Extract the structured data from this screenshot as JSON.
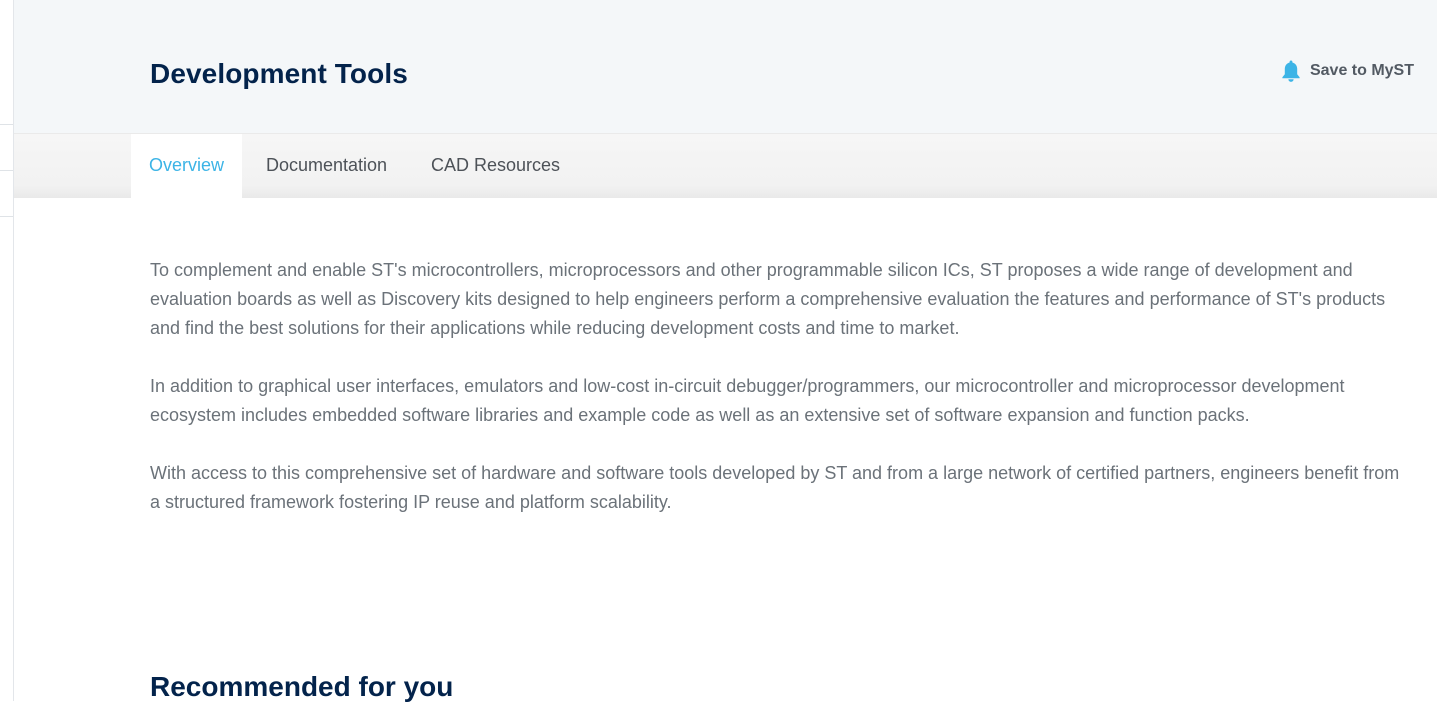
{
  "header": {
    "title": "Development Tools",
    "save_label": "Save to MyST",
    "save_icon": "bell-icon"
  },
  "tabs": [
    {
      "label": "Overview",
      "active": true
    },
    {
      "label": "Documentation",
      "active": false
    },
    {
      "label": "CAD Resources",
      "active": false
    }
  ],
  "overview": {
    "paragraphs": [
      "To complement and enable ST's microcontrollers, microprocessors and other programmable silicon ICs, ST proposes a wide range of development and evaluation boards as well as Discovery kits designed to help engineers perform a comprehensive evaluation the features and performance of ST's products and find the best solutions for their applications while reducing development costs and time to market.",
      "In addition to graphical user interfaces, emulators and low-cost in-circuit debugger/programmers, our microcontroller and microprocessor development ecosystem includes embedded software libraries and example code as well as an extensive set of software expansion and function packs.",
      "With access to this comprehensive set of hardware and software tools developed by ST and from a large network of certified partners, engineers benefit from a structured framework fostering IP reuse and platform scalability."
    ]
  },
  "recommended": {
    "heading": "Recommended for you"
  },
  "colors": {
    "title": "#03234b",
    "accent": "#3cb4e6",
    "body_text": "#6b7279",
    "header_bg": "#f4f7f9"
  }
}
